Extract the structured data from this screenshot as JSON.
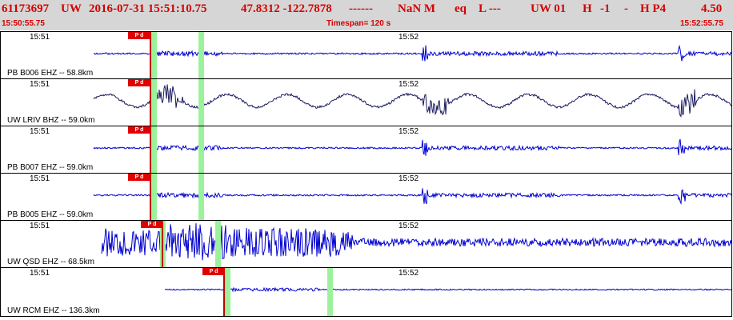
{
  "header": {
    "event_id": "61173697",
    "network": "UW",
    "datetime": "2016-07-31 15:51:10.75",
    "latlon": "47.8312 -122.7878",
    "dashes": "------",
    "magnitude": "NaN M",
    "etype": "eq",
    "flag": "L ---",
    "source": "UW 01",
    "h": "H",
    "minus1": "-1",
    "dash2": "-",
    "hp": "H P4",
    "value": "4.50",
    "start_time": "15:50:55.75",
    "timespan": "Timespan= 120 s",
    "end_time": "15:52:55.75"
  },
  "colors": {
    "trace_blue": "#0000d0",
    "trace_dark": "#1a1a5e",
    "pick_red": "#e00000",
    "header_red": "#d40000",
    "green_window": "#9cf29c",
    "header_bg": "#d6d6d6"
  },
  "panels": [
    {
      "tick1": "15:51",
      "tick2": "15:52",
      "label": "PB B006 EHZ -- 58.8km",
      "pick": "P d",
      "trace_color": "#0000d0"
    },
    {
      "tick1": "15:51",
      "tick2": "15:52",
      "label": "UW LRIV BHZ -- 59.0km",
      "pick": "P d",
      "trace_color": "#1a1a5e"
    },
    {
      "tick1": "15:51",
      "tick2": "15:52",
      "label": "PB B007 EHZ -- 59.0km",
      "pick": "P d",
      "trace_color": "#0000d0"
    },
    {
      "tick1": "15:51",
      "tick2": "15:52",
      "label": "PB B005 EHZ -- 59.0km",
      "pick": "P d",
      "trace_color": "#0000d0"
    },
    {
      "tick1": "15:51",
      "tick2": "15:52",
      "label": "UW QSD EHZ -- 68.5km",
      "pick": "P d",
      "trace_color": "#0000d0"
    },
    {
      "tick1": "15:51",
      "tick2": "15:52",
      "label": "UW RCM EHZ -- 136.3km",
      "pick": "P d",
      "trace_color": "#0000d0"
    }
  ]
}
